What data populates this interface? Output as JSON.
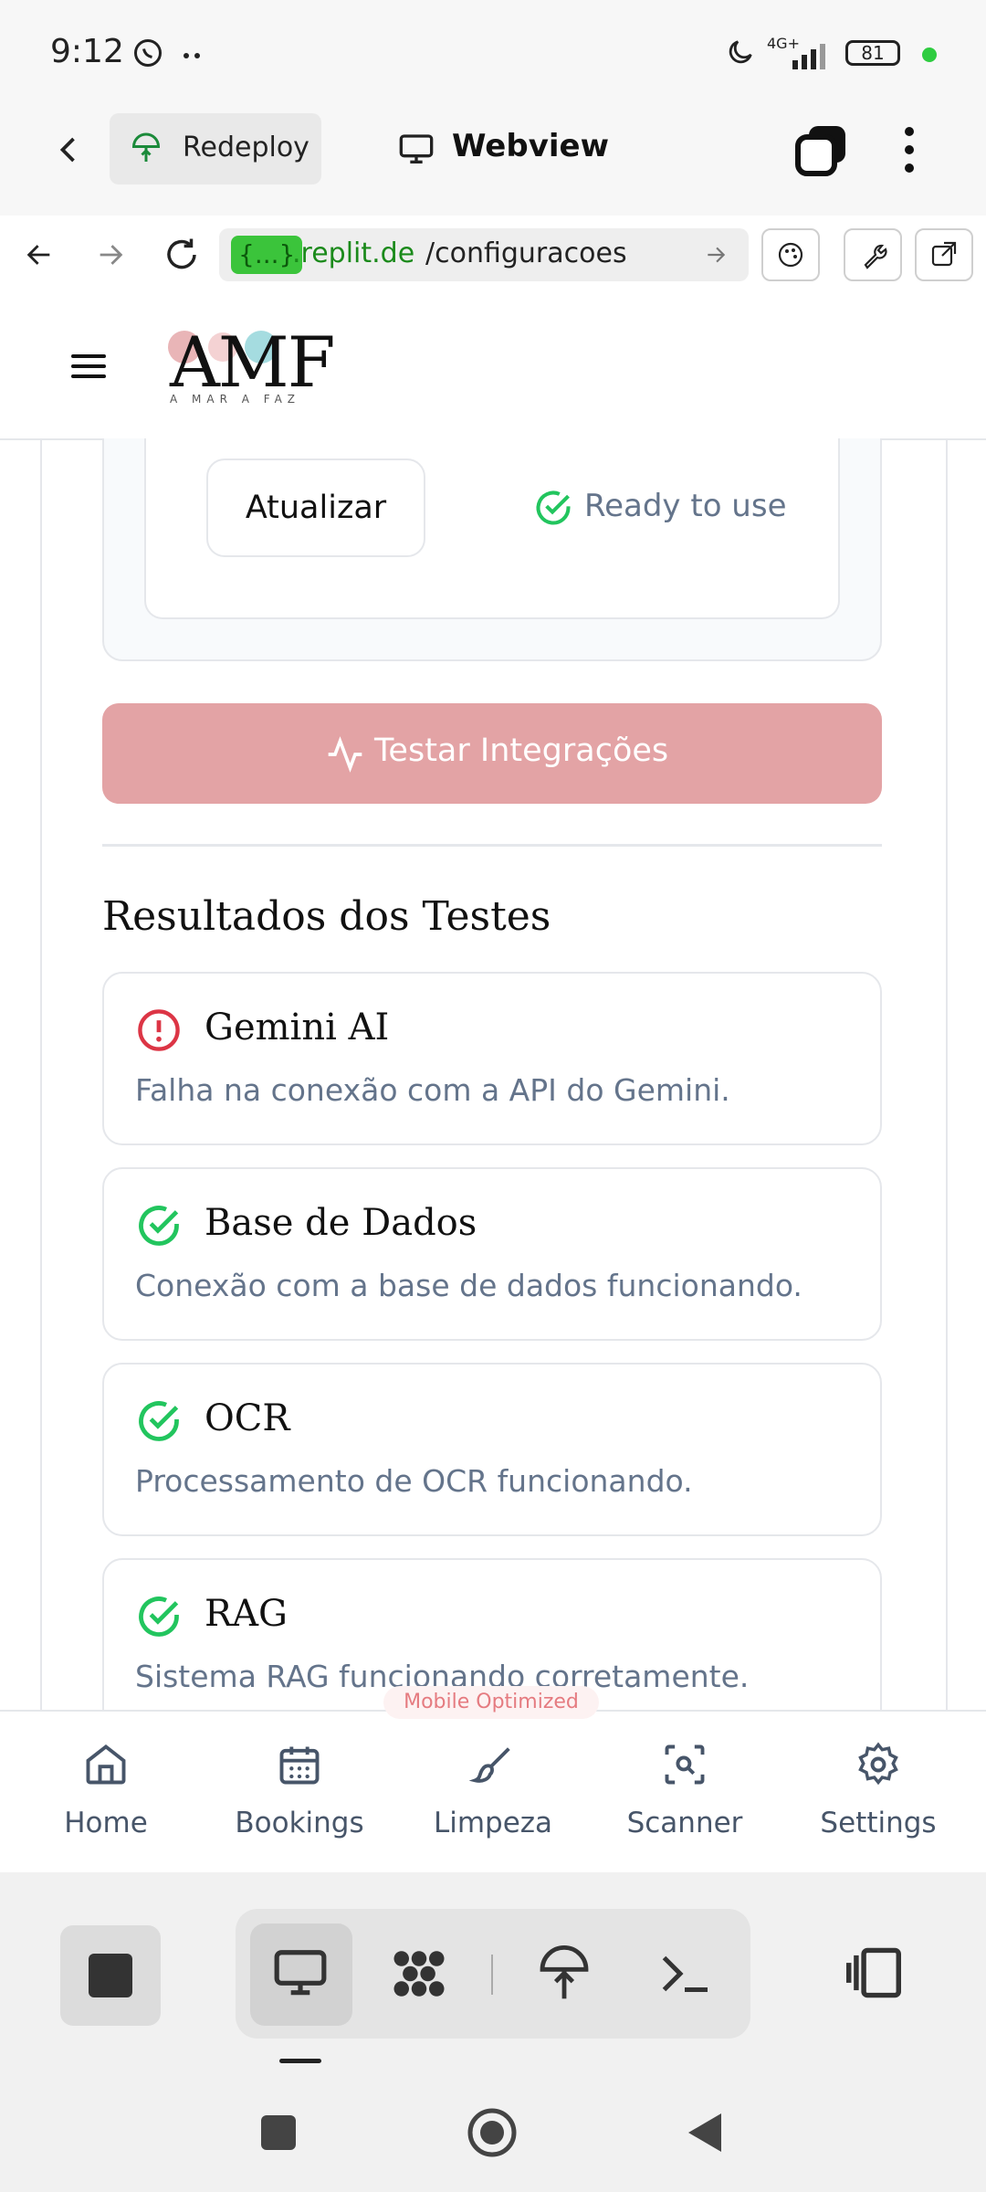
{
  "status_bar": {
    "time": "9:12",
    "network": "4G+",
    "battery": "81"
  },
  "top_bar": {
    "redeploy_label": "Redeploy",
    "webview_label": "Webview"
  },
  "browser": {
    "url_host_tag": "{...}",
    "url_host": ".replit.de",
    "url_path": "/configuracoes"
  },
  "app": {
    "logo_text": "AMF",
    "logo_subtitle": "A MAR A FAZ"
  },
  "integration": {
    "update_button": "Atualizar",
    "status_text": "Ready to use",
    "test_button": "Testar Integrações"
  },
  "results": {
    "title": "Resultados dos Testes",
    "items": [
      {
        "name": "Gemini AI",
        "message": "Falha na conexão com a API do Gemini.",
        "status": "error"
      },
      {
        "name": "Base de Dados",
        "message": "Conexão com a base de dados funcionando.",
        "status": "success"
      },
      {
        "name": "OCR",
        "message": "Processamento de OCR funcionando.",
        "status": "success"
      },
      {
        "name": "RAG",
        "message": "Sistema RAG funcionando corretamente.",
        "status": "success"
      }
    ]
  },
  "badge": "Mobile Optimized",
  "bottom_nav": [
    {
      "label": "Home",
      "icon": "home-icon"
    },
    {
      "label": "Bookings",
      "icon": "calendar-icon"
    },
    {
      "label": "Limpeza",
      "icon": "brush-icon"
    },
    {
      "label": "Scanner",
      "icon": "scan-icon"
    },
    {
      "label": "Settings",
      "icon": "gear-icon"
    }
  ],
  "colors": {
    "accent": "#e3a3a5",
    "success": "#22c55e",
    "error": "#dc3545",
    "muted_text": "#64748b"
  }
}
